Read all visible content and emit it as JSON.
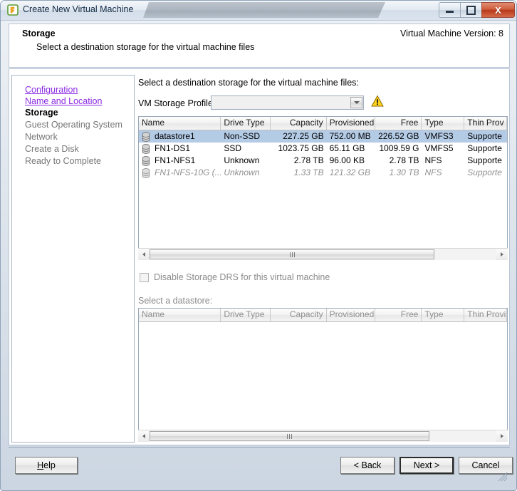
{
  "window": {
    "title": "Create New Virtual Machine",
    "app_icon": "vmware-icon",
    "controls": {
      "minimize": "minimize-icon",
      "maximize": "maximize-icon",
      "close": "X"
    }
  },
  "header": {
    "title": "Storage",
    "subtitle": "Select a destination storage for the virtual machine files",
    "version_label": "Virtual Machine Version: 8"
  },
  "sidebar": {
    "items": [
      {
        "label": "Configuration",
        "state": "link"
      },
      {
        "label": "Name and Location",
        "state": "link"
      },
      {
        "label": "Storage",
        "state": "current"
      },
      {
        "label": "Guest Operating System",
        "state": "future"
      },
      {
        "label": "Network",
        "state": "future"
      },
      {
        "label": "Create a Disk",
        "state": "future"
      },
      {
        "label": "Ready to Complete",
        "state": "future"
      }
    ]
  },
  "content": {
    "instruction": "Select a destination storage for the virtual machine files:",
    "profile_label": "VM Storage Profile:",
    "profile_value": "",
    "profile_warning_icon": "warning-triangle-icon",
    "checkbox_label": "Disable Storage DRS for this virtual machine",
    "checkbox_checked": false,
    "checkbox_enabled": false,
    "select_datastore_label": "Select a datastore:"
  },
  "datastore_table": {
    "columns": [
      "Name",
      "Drive Type",
      "Capacity",
      "Provisioned",
      "Free",
      "Type",
      "Thin Prov"
    ],
    "rows": [
      {
        "name": "datastore1",
        "drive_type": "Non-SSD",
        "capacity": "227.25 GB",
        "provisioned": "752.00 MB",
        "free": "226.52 GB",
        "type": "VMFS3",
        "thin": "Supporte",
        "selected": true,
        "enabled": true
      },
      {
        "name": "FN1-DS1",
        "drive_type": "SSD",
        "capacity": "1023.75 GB",
        "provisioned": "65.11 GB",
        "free": "1009.59 G",
        "type": "VMFS5",
        "thin": "Supporte",
        "selected": false,
        "enabled": true
      },
      {
        "name": "FN1-NFS1",
        "drive_type": "Unknown",
        "capacity": "2.78 TB",
        "provisioned": "96.00 KB",
        "free": "2.78 TB",
        "type": "NFS",
        "thin": "Supporte",
        "selected": false,
        "enabled": true
      },
      {
        "name": "FN1-NFS-10G (...",
        "drive_type": "Unknown",
        "capacity": "1.33 TB",
        "provisioned": "121.32 GB",
        "free": "1.30 TB",
        "type": "NFS",
        "thin": "Supporte",
        "selected": false,
        "enabled": false
      }
    ]
  },
  "cluster_table": {
    "columns": [
      "Name",
      "Drive Type",
      "Capacity",
      "Provisioned",
      "Free",
      "Type",
      "Thin Provi"
    ],
    "rows": []
  },
  "footer": {
    "help": "Help",
    "back": "< Back",
    "next": "Next >",
    "cancel": "Cancel"
  }
}
